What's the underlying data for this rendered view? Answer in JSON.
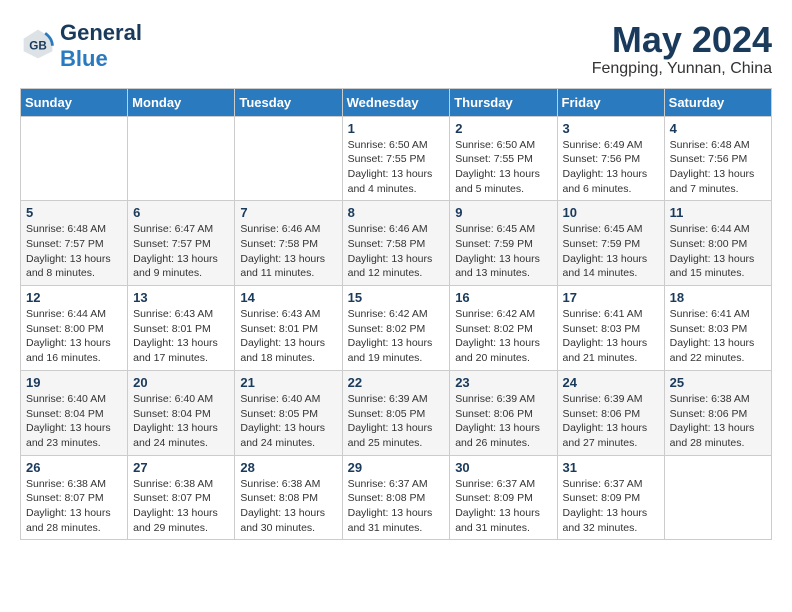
{
  "header": {
    "logo_general": "General",
    "logo_blue": "Blue",
    "title": "May 2024",
    "subtitle": "Fengping, Yunnan, China"
  },
  "calendar": {
    "weekdays": [
      "Sunday",
      "Monday",
      "Tuesday",
      "Wednesday",
      "Thursday",
      "Friday",
      "Saturday"
    ],
    "weeks": [
      [
        {
          "day": "",
          "info": ""
        },
        {
          "day": "",
          "info": ""
        },
        {
          "day": "",
          "info": ""
        },
        {
          "day": "1",
          "info": "Sunrise: 6:50 AM\nSunset: 7:55 PM\nDaylight: 13 hours\nand 4 minutes."
        },
        {
          "day": "2",
          "info": "Sunrise: 6:50 AM\nSunset: 7:55 PM\nDaylight: 13 hours\nand 5 minutes."
        },
        {
          "day": "3",
          "info": "Sunrise: 6:49 AM\nSunset: 7:56 PM\nDaylight: 13 hours\nand 6 minutes."
        },
        {
          "day": "4",
          "info": "Sunrise: 6:48 AM\nSunset: 7:56 PM\nDaylight: 13 hours\nand 7 minutes."
        }
      ],
      [
        {
          "day": "5",
          "info": "Sunrise: 6:48 AM\nSunset: 7:57 PM\nDaylight: 13 hours\nand 8 minutes."
        },
        {
          "day": "6",
          "info": "Sunrise: 6:47 AM\nSunset: 7:57 PM\nDaylight: 13 hours\nand 9 minutes."
        },
        {
          "day": "7",
          "info": "Sunrise: 6:46 AM\nSunset: 7:58 PM\nDaylight: 13 hours\nand 11 minutes."
        },
        {
          "day": "8",
          "info": "Sunrise: 6:46 AM\nSunset: 7:58 PM\nDaylight: 13 hours\nand 12 minutes."
        },
        {
          "day": "9",
          "info": "Sunrise: 6:45 AM\nSunset: 7:59 PM\nDaylight: 13 hours\nand 13 minutes."
        },
        {
          "day": "10",
          "info": "Sunrise: 6:45 AM\nSunset: 7:59 PM\nDaylight: 13 hours\nand 14 minutes."
        },
        {
          "day": "11",
          "info": "Sunrise: 6:44 AM\nSunset: 8:00 PM\nDaylight: 13 hours\nand 15 minutes."
        }
      ],
      [
        {
          "day": "12",
          "info": "Sunrise: 6:44 AM\nSunset: 8:00 PM\nDaylight: 13 hours\nand 16 minutes."
        },
        {
          "day": "13",
          "info": "Sunrise: 6:43 AM\nSunset: 8:01 PM\nDaylight: 13 hours\nand 17 minutes."
        },
        {
          "day": "14",
          "info": "Sunrise: 6:43 AM\nSunset: 8:01 PM\nDaylight: 13 hours\nand 18 minutes."
        },
        {
          "day": "15",
          "info": "Sunrise: 6:42 AM\nSunset: 8:02 PM\nDaylight: 13 hours\nand 19 minutes."
        },
        {
          "day": "16",
          "info": "Sunrise: 6:42 AM\nSunset: 8:02 PM\nDaylight: 13 hours\nand 20 minutes."
        },
        {
          "day": "17",
          "info": "Sunrise: 6:41 AM\nSunset: 8:03 PM\nDaylight: 13 hours\nand 21 minutes."
        },
        {
          "day": "18",
          "info": "Sunrise: 6:41 AM\nSunset: 8:03 PM\nDaylight: 13 hours\nand 22 minutes."
        }
      ],
      [
        {
          "day": "19",
          "info": "Sunrise: 6:40 AM\nSunset: 8:04 PM\nDaylight: 13 hours\nand 23 minutes."
        },
        {
          "day": "20",
          "info": "Sunrise: 6:40 AM\nSunset: 8:04 PM\nDaylight: 13 hours\nand 24 minutes."
        },
        {
          "day": "21",
          "info": "Sunrise: 6:40 AM\nSunset: 8:05 PM\nDaylight: 13 hours\nand 24 minutes."
        },
        {
          "day": "22",
          "info": "Sunrise: 6:39 AM\nSunset: 8:05 PM\nDaylight: 13 hours\nand 25 minutes."
        },
        {
          "day": "23",
          "info": "Sunrise: 6:39 AM\nSunset: 8:06 PM\nDaylight: 13 hours\nand 26 minutes."
        },
        {
          "day": "24",
          "info": "Sunrise: 6:39 AM\nSunset: 8:06 PM\nDaylight: 13 hours\nand 27 minutes."
        },
        {
          "day": "25",
          "info": "Sunrise: 6:38 AM\nSunset: 8:06 PM\nDaylight: 13 hours\nand 28 minutes."
        }
      ],
      [
        {
          "day": "26",
          "info": "Sunrise: 6:38 AM\nSunset: 8:07 PM\nDaylight: 13 hours\nand 28 minutes."
        },
        {
          "day": "27",
          "info": "Sunrise: 6:38 AM\nSunset: 8:07 PM\nDaylight: 13 hours\nand 29 minutes."
        },
        {
          "day": "28",
          "info": "Sunrise: 6:38 AM\nSunset: 8:08 PM\nDaylight: 13 hours\nand 30 minutes."
        },
        {
          "day": "29",
          "info": "Sunrise: 6:37 AM\nSunset: 8:08 PM\nDaylight: 13 hours\nand 31 minutes."
        },
        {
          "day": "30",
          "info": "Sunrise: 6:37 AM\nSunset: 8:09 PM\nDaylight: 13 hours\nand 31 minutes."
        },
        {
          "day": "31",
          "info": "Sunrise: 6:37 AM\nSunset: 8:09 PM\nDaylight: 13 hours\nand 32 minutes."
        },
        {
          "day": "",
          "info": ""
        }
      ]
    ]
  }
}
